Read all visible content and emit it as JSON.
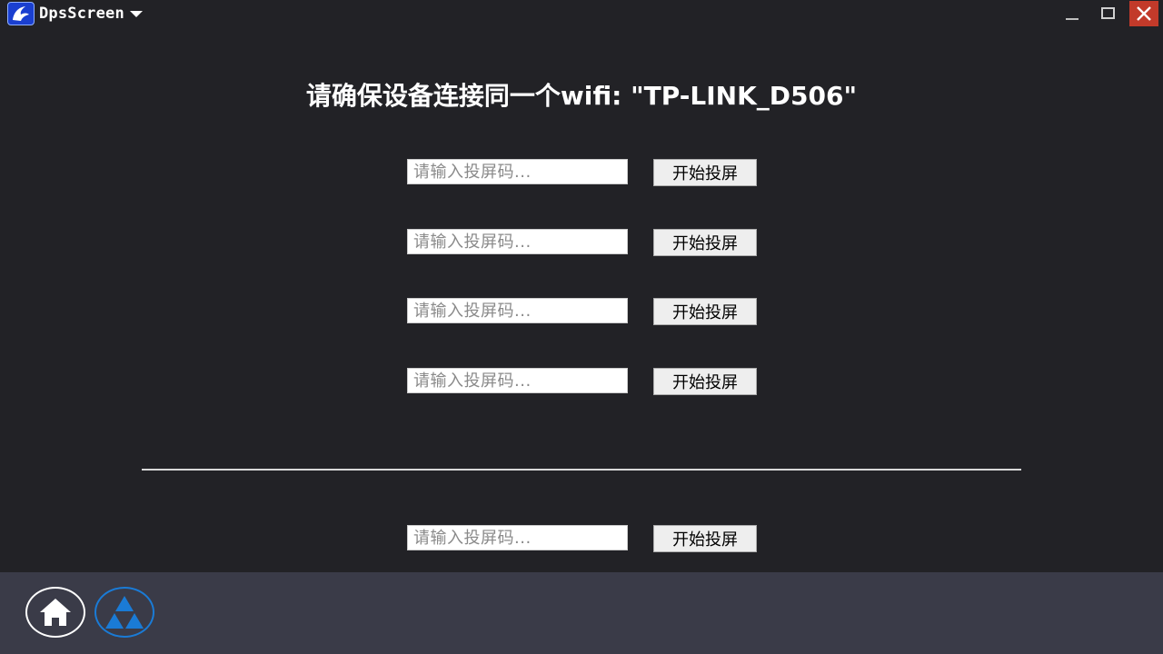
{
  "window": {
    "app_name": "DpsScreen",
    "icons": {
      "logo": "app-logo-icon",
      "menu": "chevron-down-icon",
      "minimize": "minimize-icon",
      "maximize": "maximize-icon",
      "close": "close-icon"
    }
  },
  "main": {
    "heading": "请确保设备连接同一个wifi: \"TP-LINK_D506\"",
    "rows": [
      {
        "placeholder": "请输入投屏码...",
        "button_label": "开始投屏"
      },
      {
        "placeholder": "请输入投屏码...",
        "button_label": "开始投屏"
      },
      {
        "placeholder": "请输入投屏码...",
        "button_label": "开始投屏"
      },
      {
        "placeholder": "请输入投屏码...",
        "button_label": "开始投屏"
      }
    ],
    "bottom_row": {
      "placeholder": "请输入投屏码...",
      "button_label": "开始投屏"
    }
  },
  "footer": {
    "home_icon": "home-icon",
    "app_icon": "triforce-icon"
  },
  "colors": {
    "background": "#222226",
    "bottom_bar": "#3a3b48",
    "close_button": "#c23a2a",
    "accent_blue": "#1a7bd6"
  }
}
